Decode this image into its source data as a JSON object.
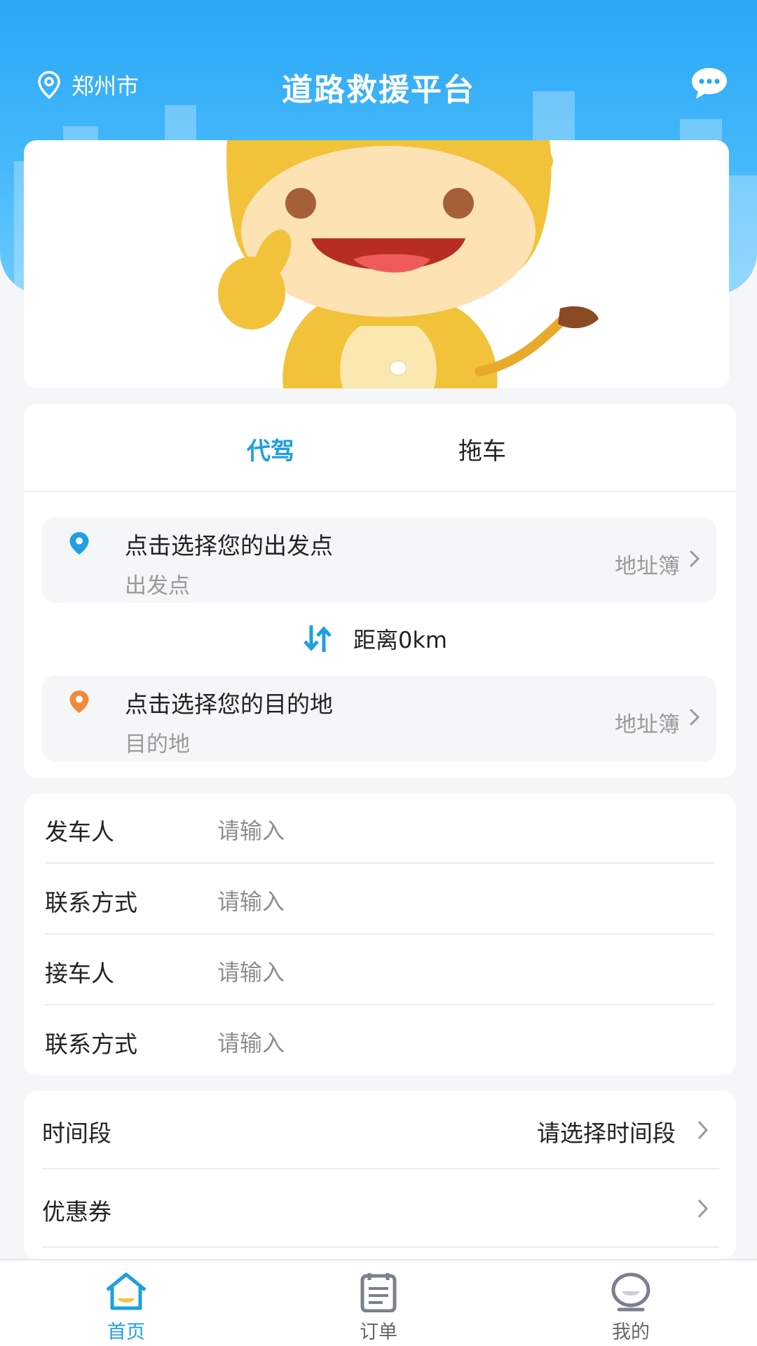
{
  "header": {
    "city": "郑州市",
    "title": "道路救援平台",
    "location_icon": "location-pin-icon",
    "message_icon": "chat-bubble-icon"
  },
  "banner": {
    "image": "cartoon-cow-mascot",
    "active_slide": 1
  },
  "service_tabs": {
    "items": [
      {
        "label": "代驾",
        "active": true
      },
      {
        "label": "拖车",
        "active": false
      }
    ],
    "accent_color": "#1e9fe2"
  },
  "route": {
    "origin": {
      "prompt": "点击选择您的出发点",
      "placeholder": "出发点",
      "address_book": "地址簿",
      "pin_color": "#1e9fe2"
    },
    "distance_text": "距离0km",
    "destination": {
      "prompt": "点击选择您的目的地",
      "placeholder": "目的地",
      "address_book": "地址簿",
      "pin_color": "#f08a3c"
    }
  },
  "contacts": {
    "rows": [
      {
        "label": "发车人",
        "placeholder": "请输入"
      },
      {
        "label": "联系方式",
        "placeholder": "请输入"
      },
      {
        "label": "接车人",
        "placeholder": "请输入"
      },
      {
        "label": "联系方式",
        "placeholder": "请输入"
      }
    ]
  },
  "options": {
    "time": {
      "label": "时间段",
      "value": "请选择时间段"
    },
    "coupon": {
      "label": "优惠券",
      "value": ""
    }
  },
  "bottom_nav": {
    "items": [
      {
        "label": "首页",
        "icon": "home-icon",
        "active": true
      },
      {
        "label": "订单",
        "icon": "order-list-icon",
        "active": false
      },
      {
        "label": "我的",
        "icon": "profile-icon",
        "active": false
      }
    ]
  }
}
